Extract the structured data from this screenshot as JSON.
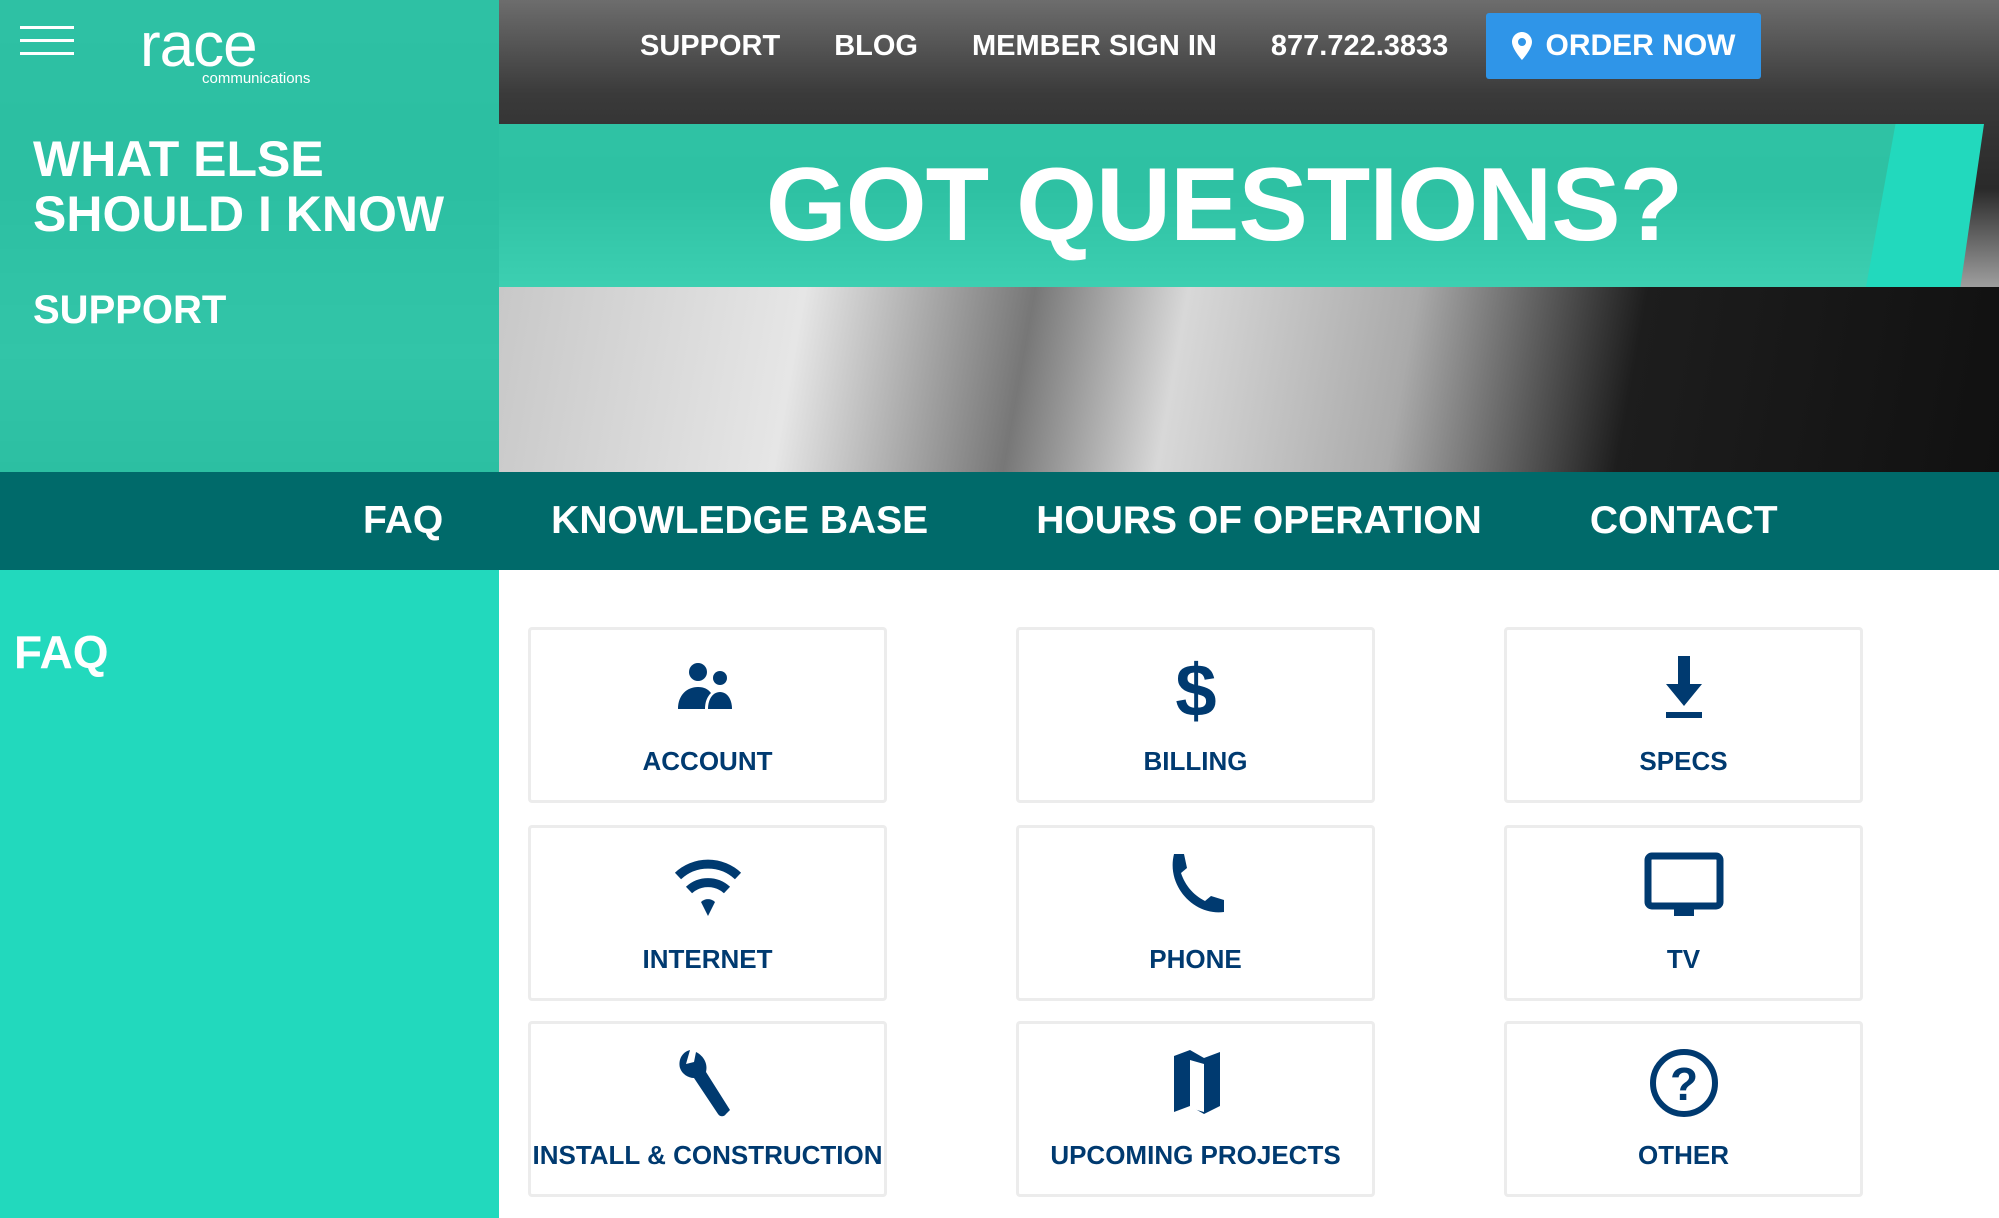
{
  "header": {
    "logo_text": "race",
    "logo_sub": "communications",
    "nav": [
      "SUPPORT",
      "BLOG",
      "MEMBER SIGN IN",
      "877.722.3833"
    ],
    "order_button": "ORDER NOW"
  },
  "hero": {
    "side_title_1": "WHAT ELSE",
    "side_title_2": "SHOULD I KNOW",
    "side_subtitle": "SUPPORT",
    "headline": "GOT QUESTIONS?"
  },
  "subnav": [
    "FAQ",
    "KNOWLEDGE BASE",
    "HOURS OF OPERATION",
    "CONTACT"
  ],
  "faq": {
    "heading": "FAQ",
    "tiles": [
      {
        "label": "ACCOUNT",
        "icon": "users-icon"
      },
      {
        "label": "BILLING",
        "icon": "dollar-icon"
      },
      {
        "label": "SPECS",
        "icon": "download-icon"
      },
      {
        "label": "INTERNET",
        "icon": "wifi-icon"
      },
      {
        "label": "PHONE",
        "icon": "phone-icon"
      },
      {
        "label": "TV",
        "icon": "tv-icon"
      },
      {
        "label": "INSTALL & CONSTRUCTION",
        "icon": "wrench-icon"
      },
      {
        "label": "UPCOMING PROJECTS",
        "icon": "map-icon"
      },
      {
        "label": "OTHER",
        "icon": "question-circle-icon"
      }
    ]
  },
  "colors": {
    "teal": "#22d9bd",
    "dark_teal": "#006a6a",
    "navy": "#003a70",
    "order_blue": "#2f95e8"
  }
}
